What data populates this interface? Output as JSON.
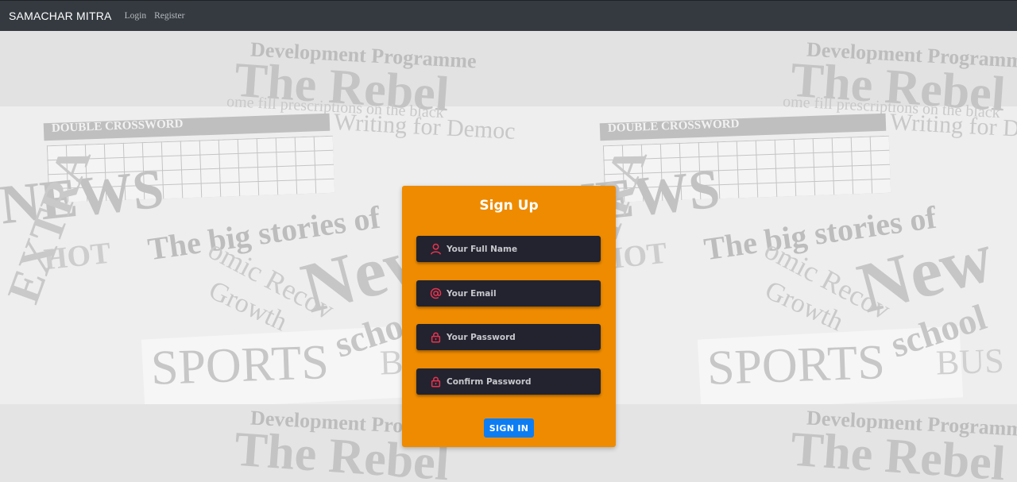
{
  "navbar": {
    "brand": "SAMACHAR MITRA",
    "links": [
      "Login",
      "Register"
    ]
  },
  "background": {
    "headlines": [
      "Development Programme",
      "The Rebel",
      "ome fill prescriptions on the black",
      "Writing for Democ",
      "DOUBLE CROSSWORD",
      "NEWS",
      "The big stories of",
      "HOT",
      "EXTRA",
      "Growth",
      "omic Recov",
      "SPORTS",
      "BUS",
      "New",
      "school"
    ]
  },
  "signup": {
    "title": "Sign Up",
    "fields": [
      {
        "placeholder": "Your Full Name",
        "icon": "user-icon",
        "type": "text"
      },
      {
        "placeholder": "Your Email",
        "icon": "at-icon",
        "type": "email"
      },
      {
        "placeholder": "Your Password",
        "icon": "lock-icon",
        "type": "password"
      },
      {
        "placeholder": "Confirm Password",
        "icon": "lock-icon",
        "type": "password"
      }
    ],
    "button_label": "SIGN IN"
  },
  "colors": {
    "navbar": "#343a40",
    "card": "#ee8b00",
    "field": "#22232f",
    "icon": "#e8334f",
    "button": "#0d7df4"
  }
}
